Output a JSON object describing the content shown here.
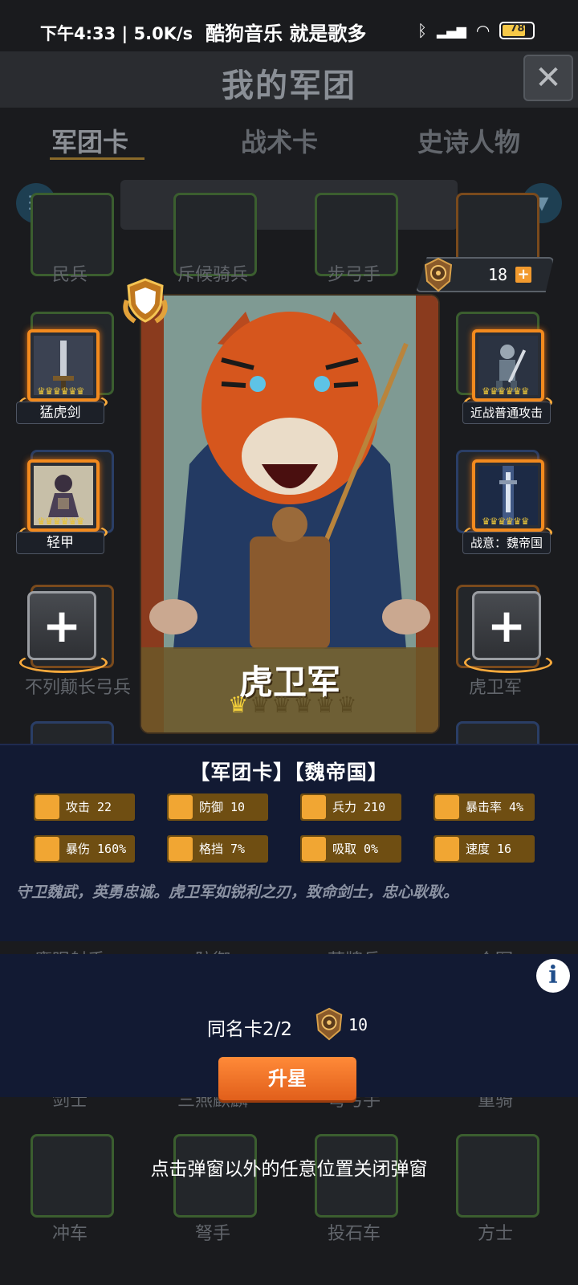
{
  "status_bar": {
    "time": "下午4:33 | 5.0K/s",
    "notification": "酷狗音乐 就是歌多",
    "battery": "78"
  },
  "background": {
    "page_title": "我的军团",
    "tabs": [
      "军团卡",
      "战术卡",
      "史诗人物"
    ],
    "grid_labels": [
      "民兵",
      "斥候骑兵",
      "步弓手",
      "不列颠长弓兵",
      "虎卫军",
      "鹰眼射手",
      "防御",
      "藤牌兵",
      "众军",
      "剑士",
      "三燕麒麟",
      "弩弓手",
      "重骑",
      "冲车",
      "弩手",
      "投石车",
      "方士"
    ]
  },
  "currency": {
    "count": "18",
    "icon": "crest-medal-icon",
    "plus_icon": "plus-icon"
  },
  "equipment": {
    "left": [
      {
        "label": "猛虎剑",
        "icon": "sword-icon"
      },
      {
        "label": "轻甲",
        "icon": "armored-figure-icon"
      }
    ],
    "right": [
      {
        "label": "近战普通攻击",
        "icon": "knight-icon"
      },
      {
        "label": "战意：魏帝国",
        "icon": "sword-in-light-icon"
      }
    ],
    "empty_slot_icon": "plus-icon"
  },
  "card": {
    "name": "虎卫军",
    "stars_total": 6,
    "stars_filled": 1,
    "accent": "#f1a633",
    "name_bar_color": "#6c5628"
  },
  "info": {
    "heading": "【军团卡】【魏帝国】",
    "stats": [
      {
        "label": "攻击 22",
        "icon": "sword-icon"
      },
      {
        "label": "防御 10",
        "icon": "shield-icon"
      },
      {
        "label": "兵力 210",
        "icon": "heart-icon"
      },
      {
        "label": "暴击率 4%",
        "icon": "target-icon"
      },
      {
        "label": "暴伤 160%",
        "icon": "burst-icon"
      },
      {
        "label": "格挡 7%",
        "icon": "block-shield-icon"
      },
      {
        "label": "吸取 0%",
        "icon": "drain-icon"
      },
      {
        "label": "速度 16",
        "icon": "boot-icon"
      }
    ],
    "description": "守卫魏武，英勇忠诚。虎卫军如锐利之刃，致命剑士，忠心耿耿。"
  },
  "upgrade": {
    "dup_count": "同名卡2/2",
    "cost": "10",
    "button": "升星",
    "info_icon": "info-icon"
  },
  "close_hint": "点击弹窗以外的任意位置关闭弹窗",
  "colors": {
    "panel": "#121a33",
    "equip_border": "#f28a1e",
    "button": "#ef6f24"
  }
}
